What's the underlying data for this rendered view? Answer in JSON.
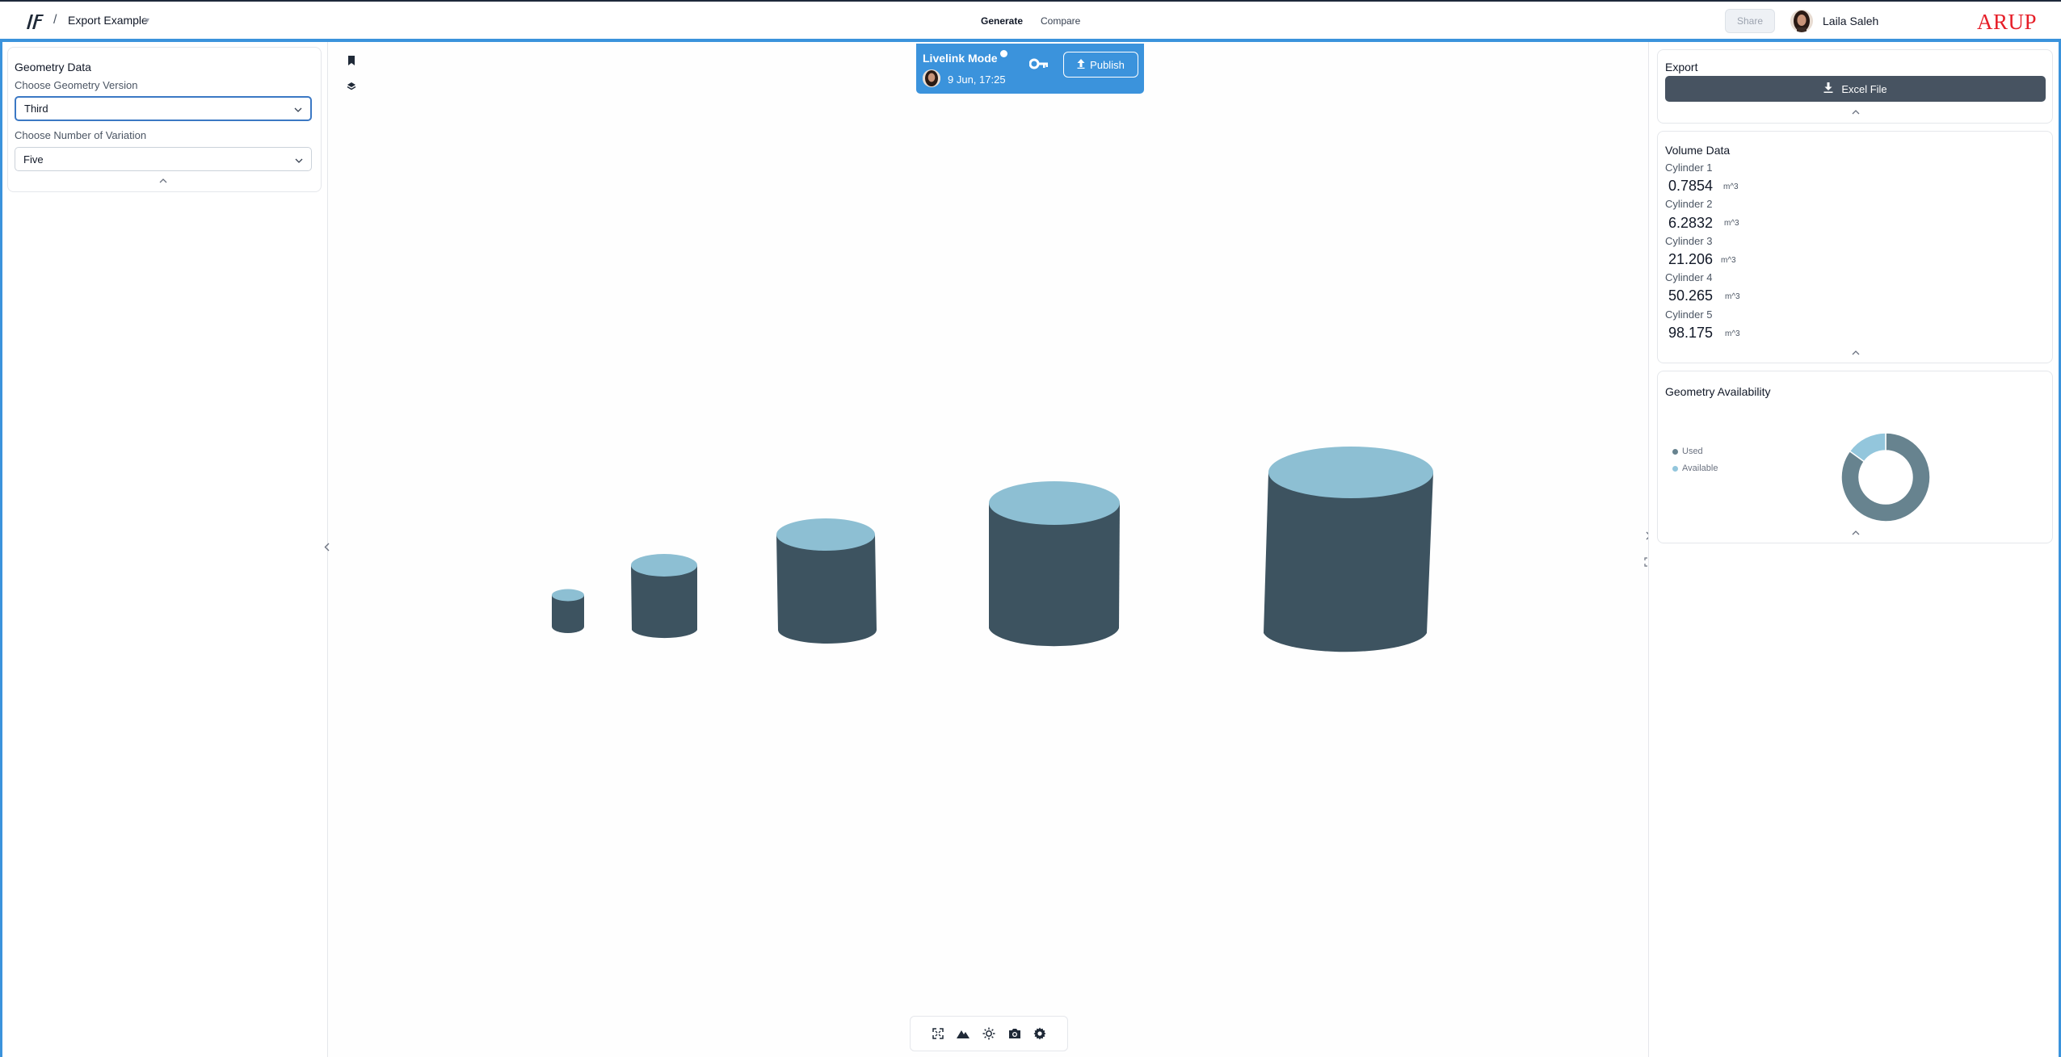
{
  "header": {
    "separator": "/",
    "app_name": "Export Example",
    "nav": {
      "generate": "Generate",
      "compare": "Compare"
    },
    "share_label": "Share",
    "user_name": "Laila Saleh",
    "brand": "ARUP"
  },
  "left": {
    "title": "Geometry Data",
    "version_label": "Choose Geometry Version",
    "version_value": "Third",
    "variation_label": "Choose Number of Variation",
    "variation_value": "Five"
  },
  "livelink": {
    "title": "Livelink Mode",
    "time": "9 Jun, 17:25",
    "publish_label": "Publish"
  },
  "export": {
    "title": "Export",
    "button_label": "Excel File"
  },
  "volume": {
    "title": "Volume Data",
    "items": [
      {
        "label": "Cylinder 1",
        "value": "0.7854",
        "unit": "m^3"
      },
      {
        "label": "Cylinder 2",
        "value": "6.2832",
        "unit": "m^3"
      },
      {
        "label": "Cylinder 3",
        "value": "21.206",
        "unit": "m^3"
      },
      {
        "label": "Cylinder 4",
        "value": "50.265",
        "unit": "m^3"
      },
      {
        "label": "Cylinder 5",
        "value": "98.175",
        "unit": "m^3"
      }
    ]
  },
  "availability": {
    "title": "Geometry Availability",
    "legend": [
      {
        "label": "Used",
        "color": "#67838f"
      },
      {
        "label": "Available",
        "color": "#93c6dc"
      }
    ],
    "chart_data": {
      "type": "pie",
      "categories": [
        "Used",
        "Available"
      ],
      "values": [
        0.85,
        0.15
      ],
      "colors": [
        "#67838f",
        "#93c6dc"
      ]
    }
  },
  "colors": {
    "accent": "#3b93dc",
    "cylinder_side": "#3d5360",
    "cylinder_top": "#8dbfd3",
    "button_dark": "#475361",
    "brand_red": "#e61e28"
  },
  "icons": {
    "logo": "viktor-logo-icon",
    "bookmark": "bookmark-icon",
    "layers": "layers-icon",
    "key": "key-icon",
    "upload": "upload-icon",
    "download": "download-icon",
    "fit": "fit-view-icon",
    "terrain": "terrain-icon",
    "light": "light-icon",
    "camera": "camera-icon",
    "settings": "gear-icon"
  }
}
